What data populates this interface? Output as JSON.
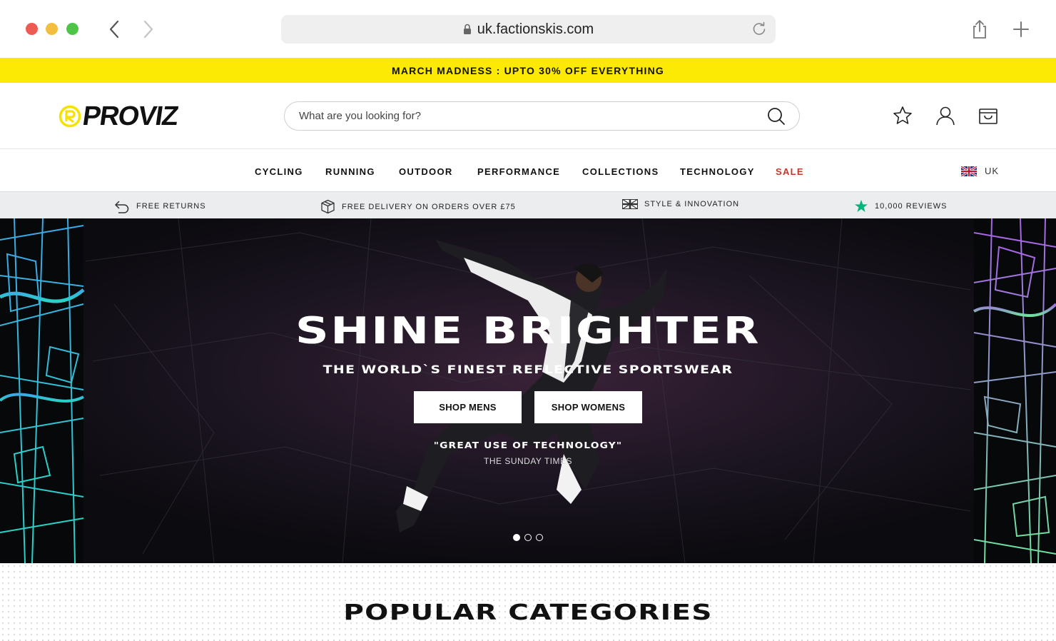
{
  "browser": {
    "url": "uk.factionskis.com"
  },
  "promo": {
    "text": "MARCH MADNESS : UPTO 30% OFF EVERYTHING",
    "background": "#fcea04"
  },
  "header": {
    "logo_text": "PROVIZ",
    "search_placeholder": "What are you looking for?",
    "icons": [
      "star-icon",
      "user-icon",
      "bag-icon"
    ]
  },
  "nav": {
    "items": [
      "CYCLING",
      "RUNNING",
      "OUTDOOR",
      "PERFORMANCE",
      "COLLECTIONS",
      "TECHNOLOGY",
      "SALE"
    ],
    "sale_color": "#c0392b",
    "locale": "UK"
  },
  "usp": {
    "items": [
      "FREE RETURNS",
      "FREE DELIVERY ON ORDERS OVER £75",
      "STYLE & INNOVATION",
      "10,000 REVIEWS"
    ],
    "review_star_color": "#00b67a"
  },
  "hero": {
    "title": "SHINE BRIGHTER",
    "subtitle": "THE WORLD`S FINEST REFLECTIVE SPORTSWEAR",
    "buttons": [
      "SHOP MENS",
      "SHOP WOMENS"
    ],
    "quote": "\"GREAT USE OF TECHNOLOGY\"",
    "quote_source": "THE SUNDAY TIMES",
    "slides": 3,
    "active_slide": 1
  },
  "popular": {
    "heading": "POPULAR CATEGORIES"
  }
}
